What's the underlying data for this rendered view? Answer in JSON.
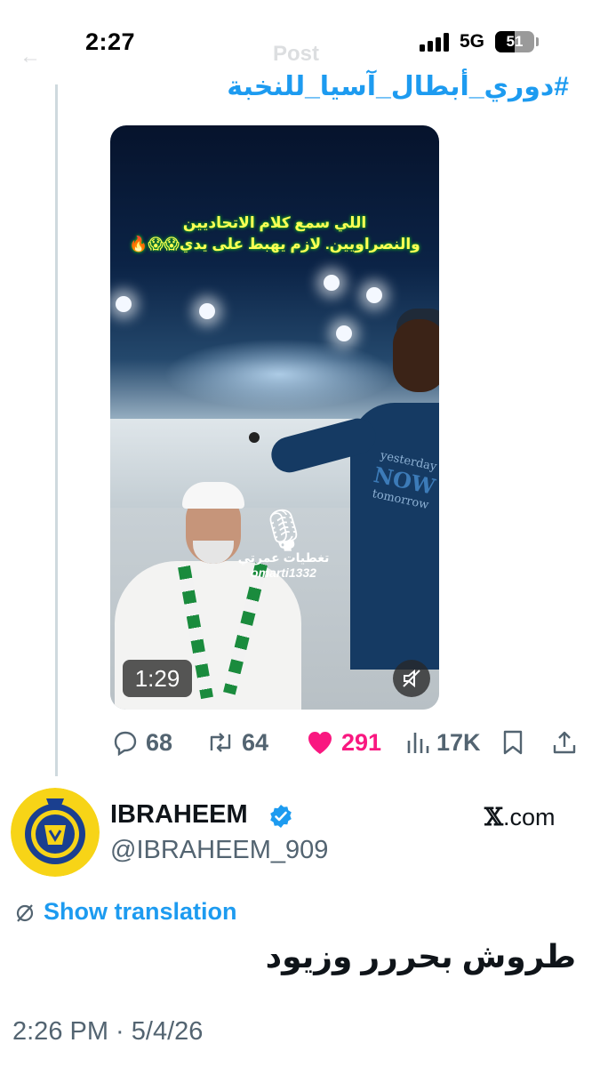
{
  "status_bar": {
    "time": "2:27",
    "network": "5G",
    "battery_level": "51",
    "battery_fraction": 0.51
  },
  "header": {
    "back_icon": "arrow-left-icon",
    "title": "Post"
  },
  "quoted_tweet": {
    "hashtag": "#دوري_أبطال_آسيا_للنخبة",
    "video": {
      "caption_line1": "اللي سمع كلام الاتحاديين",
      "caption_line2": "والنصراويين. لازم يهبط على يدي😱😱🔥",
      "watermark_arabic": "تغطيات عمرتي",
      "watermark_handle": "omarti1332",
      "shirt_text_top": "yesterday",
      "shirt_text_mid": "NOW",
      "shirt_text_bottom": "tomorrow",
      "duration": "1:29",
      "mute_icon": "speaker-muted-icon"
    },
    "actions": {
      "replies": "68",
      "reposts": "64",
      "likes": "291",
      "views": "17K",
      "icons": [
        "reply-icon",
        "repost-icon",
        "heart-icon",
        "views-icon",
        "bookmark-icon",
        "share-icon"
      ],
      "like_color": "#f91880"
    }
  },
  "tweet": {
    "display_name": "IBRAHEEM",
    "handle": "@IBRAHEEM_909",
    "source": ".com",
    "source_logo": "𝕏",
    "show_translation": "Show translation",
    "text": "طروش بحررر وزيود",
    "timestamp": "2:26 PM · 5/4/26"
  },
  "colors": {
    "accent": "#1d9bf0",
    "secondary_text": "#536471",
    "primary_text": "#0f1419"
  }
}
